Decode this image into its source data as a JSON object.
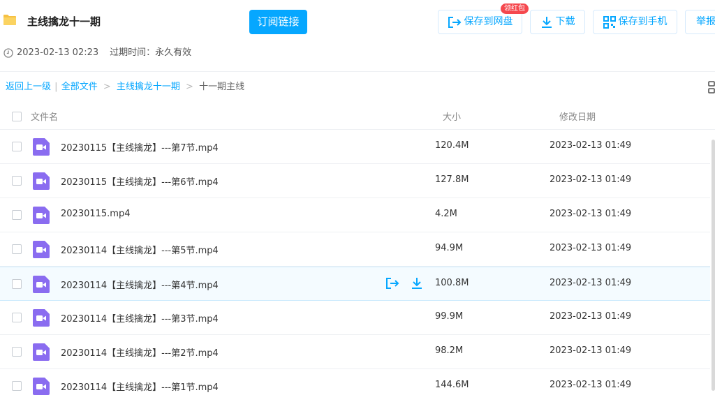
{
  "header": {
    "title": "主线擒龙十一期",
    "subscribe_label": "订阅链接",
    "save_netdisk_label": "保存到网盘",
    "red_badge": "领红包",
    "download_label": "下载",
    "save_phone_label": "保存到手机",
    "report_label": "举报",
    "created": "2023-02-13 02:23",
    "expire": "过期时间：永久有效"
  },
  "breadcrumb": {
    "back": "返回上一级",
    "sep1": "|",
    "all_files": "全部文件",
    "arrow1": ">",
    "folder": "主线擒龙十一期",
    "arrow2": ">",
    "current": "十一期主线"
  },
  "table": {
    "col_name": "文件名",
    "col_size": "大小",
    "col_date": "修改日期",
    "rows": [
      {
        "name": "20230115【主线擒龙】---第7节.mp4",
        "size": "120.4M",
        "date": "2023-02-13 01:49"
      },
      {
        "name": "20230115【主线擒龙】---第6节.mp4",
        "size": "127.8M",
        "date": "2023-02-13 01:49"
      },
      {
        "name": "20230115.mp4",
        "size": "4.2M",
        "date": "2023-02-13 01:49"
      },
      {
        "name": "20230114【主线擒龙】---第5节.mp4",
        "size": "94.9M",
        "date": "2023-02-13 01:49"
      },
      {
        "name": "20230114【主线擒龙】---第4节.mp4",
        "size": "100.8M",
        "date": "2023-02-13 01:49"
      },
      {
        "name": "20230114【主线擒龙】---第3节.mp4",
        "size": "99.9M",
        "date": "2023-02-13 01:49"
      },
      {
        "name": "20230114【主线擒龙】---第2节.mp4",
        "size": "98.2M",
        "date": "2023-02-13 01:49"
      },
      {
        "name": "20230114【主线擒龙】---第1节.mp4",
        "size": "144.6M",
        "date": "2023-02-13 01:49"
      }
    ]
  },
  "colors": {
    "accent": "#06a7ff",
    "video_icon": "#8a6cf0",
    "badge": "#f5484e",
    "folder": "#f6c143"
  },
  "icons": {
    "folder": "folder-icon",
    "save": "save-to-netdisk-icon",
    "download": "download-icon",
    "qrcode": "qrcode-icon",
    "clock": "clock-icon",
    "grid": "grid-view-icon",
    "video": "video-file-icon"
  }
}
